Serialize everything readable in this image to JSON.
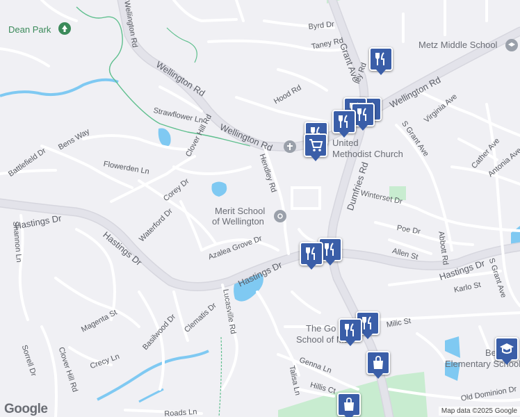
{
  "map": {
    "attribution": "Map data ©2025 Google",
    "logo": "Google",
    "colors": {
      "background": "#f0f0f4",
      "road": "#ffffff",
      "road_outline": "#d6d6de",
      "major_road": "#dcdce4",
      "water": "#7fc9f2",
      "park": "#c8ecd0",
      "trail": "#5fbf8e",
      "pin": "#3a5ea8"
    }
  },
  "street_labels": [
    "Wellington Rd",
    "Wellington Rd",
    "Wellington Rd",
    "Wellington Rd",
    "Byrd Dr",
    "Taney Rd",
    "Grant Ave",
    "Hood Rd",
    "Virginia Ave",
    "S Grant Ave",
    "Cather Ave",
    "Antonia Ave",
    "Strawflower Ln",
    "Clover Hill Rd",
    "Bens Way",
    "Battlefield Dr",
    "Flowerden Ln",
    "Hendley Rd",
    "Corey Dr",
    "Dumfries Rd",
    "Winterset Dr",
    "Hastings Dr",
    "Hastings Dr",
    "Hastings Dr",
    "Hastings Dr",
    "Waterford Dr",
    "Shannon Ln",
    "Azalea Grove Dr",
    "Poe Dr",
    "Abbott Rd",
    "Allen St",
    "S Grant Ave",
    "Karlo St",
    "Lucasville Rd",
    "Clematis Dr",
    "Magenta St",
    "Basilwood Dr",
    "Milic St",
    "Sorrell Dr",
    "Clover Hill Rd",
    "Crecy Ln",
    "Genna Ln",
    "Talisa Ln",
    "Hillis Ct",
    "Old Dominion Dr",
    "Roads Ln",
    "ley Rd"
  ],
  "places": {
    "dean_park": "Dean Park",
    "metz_school": "Metz Middle School",
    "church_line1": "United",
    "church_line2": "Methodist Church",
    "merit_line1": "Merit School",
    "merit_line2": "of Wellington",
    "goddard_line1": "The Go",
    "goddard_line2": "School of Man",
    "bennett_line1": "Bennet",
    "bennett_line2": "Elementary School"
  },
  "pins": [
    {
      "icon": "restaurant-icon"
    },
    {
      "icon": "restaurant-icon"
    },
    {
      "icon": "restaurant-icon"
    },
    {
      "icon": "restaurant-icon"
    },
    {
      "icon": "restaurant-icon"
    },
    {
      "icon": "grocery-cart-icon"
    },
    {
      "icon": "restaurant-icon"
    },
    {
      "icon": "restaurant-icon"
    },
    {
      "icon": "restaurant-icon"
    },
    {
      "icon": "restaurant-icon"
    },
    {
      "icon": "restaurant-icon"
    },
    {
      "icon": "shopping-bag-icon"
    },
    {
      "icon": "shopping-bag-icon"
    },
    {
      "icon": "school-cap-icon"
    }
  ]
}
